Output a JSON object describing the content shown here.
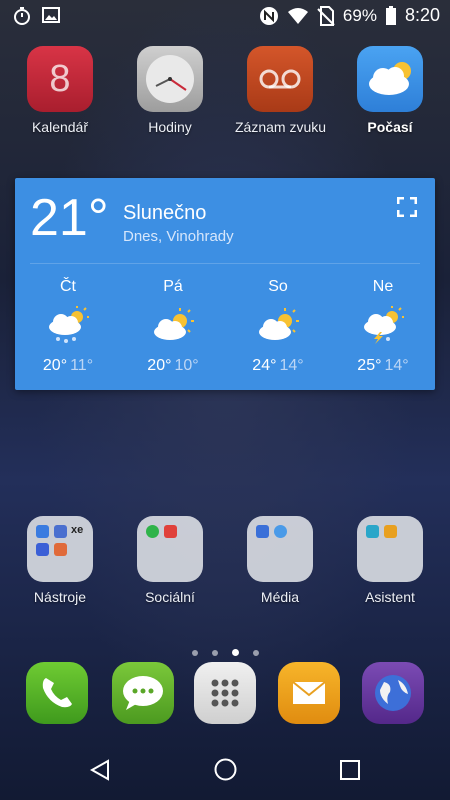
{
  "status_bar": {
    "battery": "69%",
    "time": "8:20",
    "icons": [
      "timer-icon",
      "image-icon",
      "nfc-icon",
      "wifi-icon",
      "no-sim-icon",
      "battery-icon"
    ]
  },
  "apps_row1": [
    {
      "label": "Kalendář",
      "icon": "calendar-icon",
      "color": "#c72637"
    },
    {
      "label": "Hodiny",
      "icon": "clock-icon",
      "color": "#b9b9b9"
    },
    {
      "label": "Záznam zvuku",
      "icon": "voice-recorder-icon",
      "color": "#c1451f"
    },
    {
      "label": "Počasí",
      "icon": "weather-icon",
      "color": "#3a8fe6"
    }
  ],
  "calendar_digit": "8",
  "weather_widget": {
    "temperature": "21°",
    "condition": "Slunečno",
    "location": "Dnes, Vinohrady",
    "forecast": [
      {
        "day": "Čt",
        "high": "20°",
        "low": "11°",
        "icon": "cloud-rain-sun-icon"
      },
      {
        "day": "Pá",
        "high": "20°",
        "low": "10°",
        "icon": "partly-cloudy-icon"
      },
      {
        "day": "So",
        "high": "24°",
        "low": "14°",
        "icon": "partly-cloudy-icon"
      },
      {
        "day": "Ne",
        "high": "25°",
        "low": "14°",
        "icon": "thunderstorm-sun-icon"
      }
    ]
  },
  "folders": [
    {
      "label": "Nástroje"
    },
    {
      "label": "Sociální"
    },
    {
      "label": "Média"
    },
    {
      "label": "Asistent"
    }
  ],
  "folder_mini_text": "xe",
  "page_indicator": {
    "count": 4,
    "active": 2
  },
  "dock": [
    {
      "name": "phone-icon",
      "color": "#4caf26"
    },
    {
      "name": "messages-icon",
      "color": "#5aa728"
    },
    {
      "name": "app-drawer-icon",
      "color": "#e0e0e0"
    },
    {
      "name": "email-icon",
      "color": "#f0a21a"
    },
    {
      "name": "browser-icon",
      "color": "#6a3a9c"
    }
  ]
}
